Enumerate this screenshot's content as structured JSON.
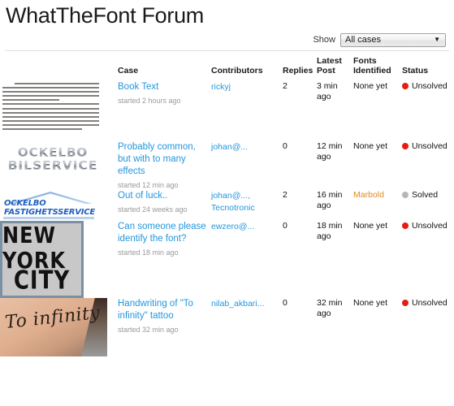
{
  "header": {
    "title": "WhatTheFont Forum"
  },
  "filter": {
    "label": "Show",
    "selected": "All cases",
    "options": [
      "All cases"
    ],
    "arrow_icon": "chevron-down-icon"
  },
  "table": {
    "columns": {
      "thumbnail": "",
      "case": "Case",
      "contributors": "Contributors",
      "replies": "Replies",
      "latest_post": "Latest Post",
      "fonts_identified": "Fonts Identified",
      "status": "Status"
    },
    "rows": [
      {
        "thumbnail_name": "book-page-scan-thumbnail",
        "title": "Book Text",
        "started": "started 2 hours ago",
        "contributors": [
          "rickyj"
        ],
        "replies": "2",
        "latest_post": "3 min ago",
        "fonts_identified": "None yet",
        "fonts_identified_is_link": false,
        "status": "Unsolved",
        "status_color": "#e81b12"
      },
      {
        "thumbnail_name": "ockelbo-bilservice-logo-thumbnail",
        "thumb_text_line1": "OCKELBO",
        "thumb_text_line2": "BILSERVICE",
        "title": "Probably common, but with to many effects",
        "started": "started 12 min ago",
        "contributors": [
          "johan@..."
        ],
        "replies": "0",
        "latest_post": "12 min ago",
        "fonts_identified": "None yet",
        "fonts_identified_is_link": false,
        "status": "Unsolved",
        "status_color": "#e81b12"
      },
      {
        "thumbnail_name": "ockelbo-fastighetsservice-logo-thumbnail",
        "thumb_text_line1": "OCKELBO",
        "thumb_text_line2": "FASTIGHETSSERVICE",
        "title": "Out of luck..",
        "started": "started 24 weeks ago",
        "contributors": [
          "johan@...,",
          "Tecnotronic"
        ],
        "replies": "2",
        "latest_post": "16 min ago",
        "fonts_identified": "Marbold",
        "fonts_identified_is_link": true,
        "fonts_identified_color": "#e08a1e",
        "status": "Solved",
        "status_color": "#b6b6b6"
      },
      {
        "thumbnail_name": "new-york-city-shirt-thumbnail",
        "thumb_text_line1": "NEW YORK",
        "thumb_text_line2": "CITY",
        "title": "Can someone please identify the font?",
        "started": "started 18 min ago",
        "contributors": [
          "ewzero@..."
        ],
        "replies": "0",
        "latest_post": "18 min ago",
        "fonts_identified": "None yet",
        "fonts_identified_is_link": false,
        "status": "Unsolved",
        "status_color": "#e81b12"
      },
      {
        "thumbnail_name": "to-infinity-tattoo-thumbnail",
        "thumb_text_line1": "To infinity",
        "title": "Handwriting of \"To infinity\" tattoo",
        "started": "started 32 min ago",
        "contributors": [
          "nilab_akbari..."
        ],
        "replies": "0",
        "latest_post": "32 min ago",
        "fonts_identified": "None yet",
        "fonts_identified_is_link": false,
        "status": "Unsolved",
        "status_color": "#e81b12"
      }
    ]
  }
}
